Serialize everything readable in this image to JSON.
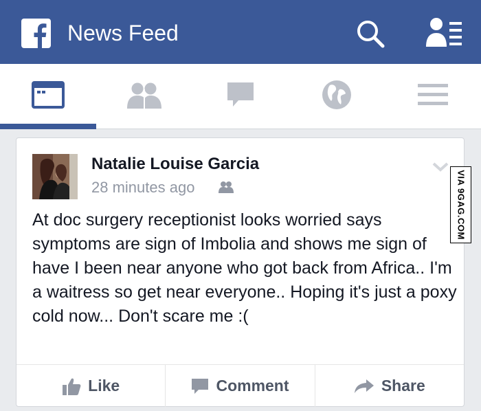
{
  "header": {
    "title": "News Feed",
    "logo_icon": "facebook-logo-icon",
    "search_icon": "search-icon",
    "friend_requests_icon": "friend-requests-icon"
  },
  "tabs": [
    {
      "name": "news-feed",
      "icon": "news-feed-icon",
      "active": true
    },
    {
      "name": "friends",
      "icon": "friends-icon",
      "active": false
    },
    {
      "name": "messages",
      "icon": "chat-bubble-icon",
      "active": false
    },
    {
      "name": "notifications",
      "icon": "globe-icon",
      "active": false
    },
    {
      "name": "more",
      "icon": "hamburger-menu-icon",
      "active": false
    }
  ],
  "post": {
    "author": "Natalie Louise Garcia",
    "time": "28 minutes ago",
    "privacy_icon": "friends-audience-icon",
    "text": "At doc surgery receptionist looks worried says symptoms are sign of Imbolia and shows me sign of have I been near anyone who got back from Africa.. I'm a waitress so get near everyone.. Hoping it's just a poxy cold now... Don't scare me :(",
    "actions": {
      "like": "Like",
      "comment": "Comment",
      "share": "Share"
    }
  },
  "watermark": "VIA 9GAG.COM",
  "colors": {
    "brand_blue": "#3b5998",
    "background": "#e9ebee",
    "icon_gray": "#bdc1c9",
    "secondary_text": "#9197a3"
  }
}
